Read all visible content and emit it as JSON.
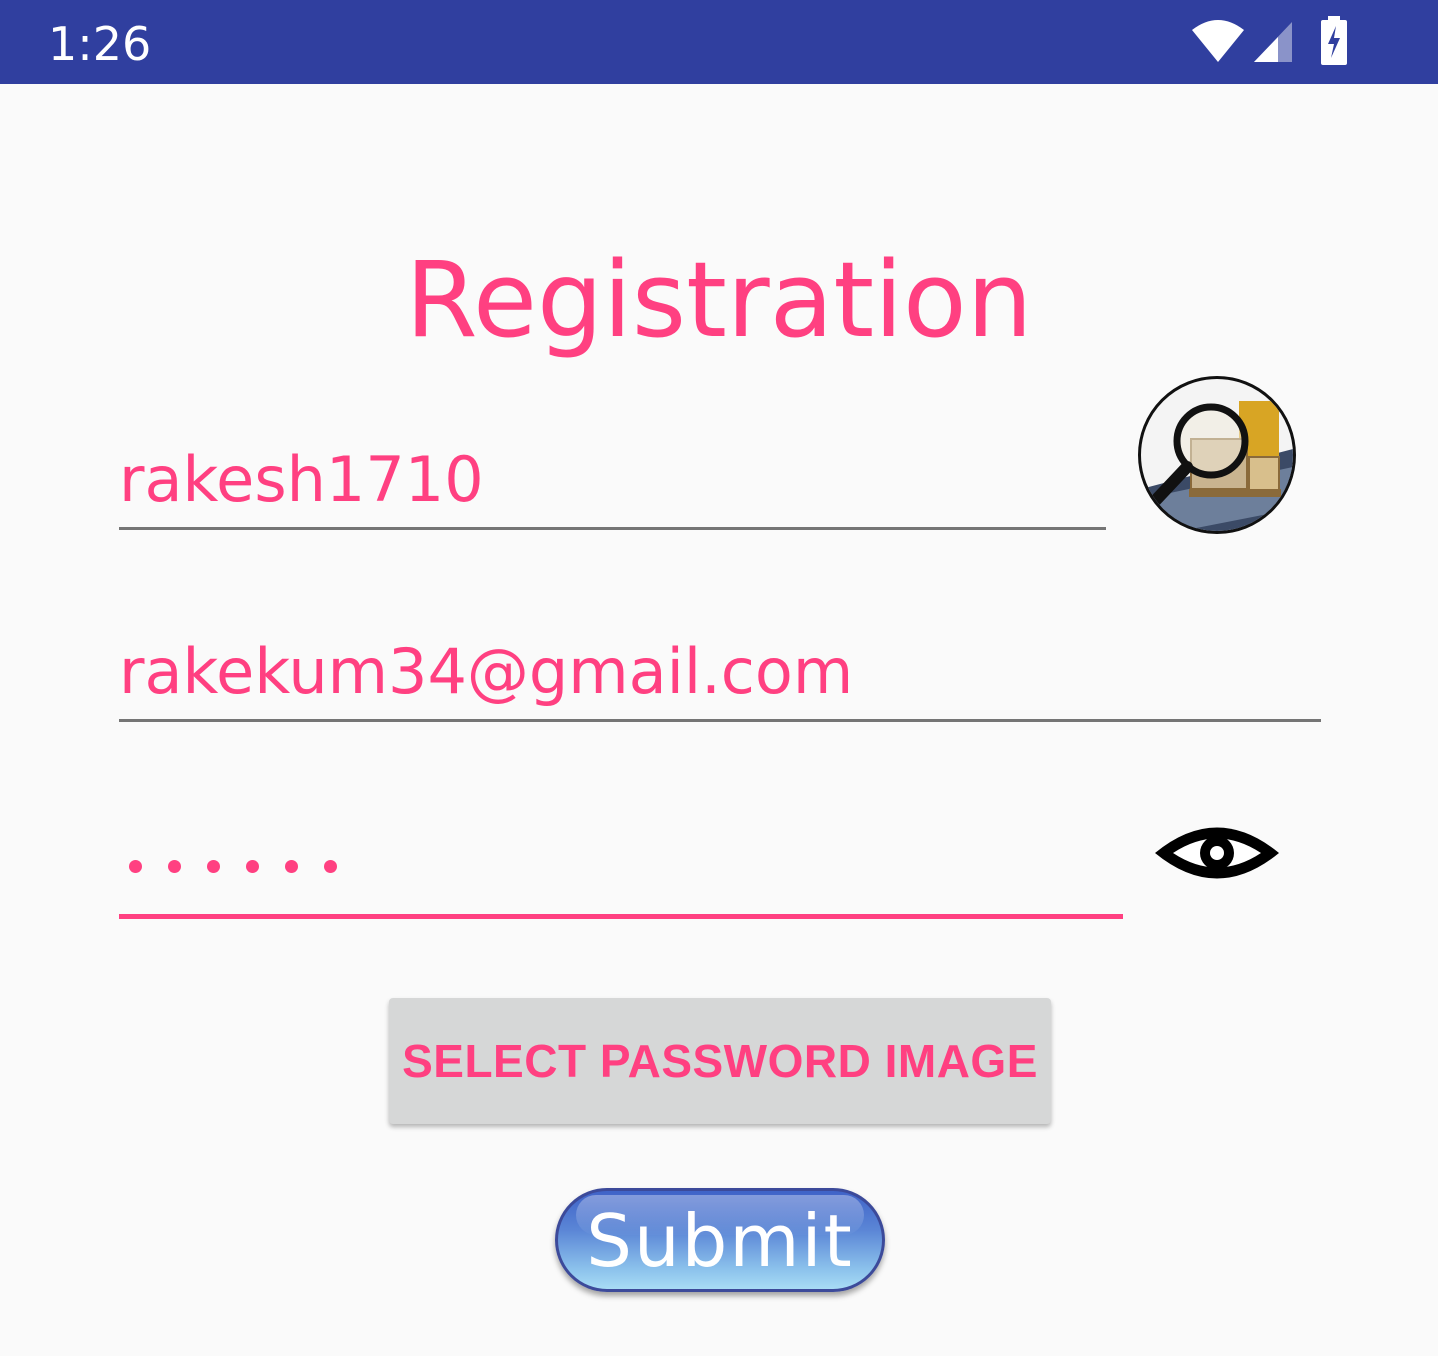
{
  "status_bar": {
    "time": "1:26",
    "icons": [
      "wifi-icon",
      "cell-signal-icon",
      "battery-charging-icon"
    ],
    "background": "#303f9f"
  },
  "form": {
    "title": "Registration",
    "username_value": "rakesh1710",
    "email_value": "rakekum34@gmail.com",
    "password_mask_length": 6,
    "select_image_label": "SELECT PASSWORD IMAGE",
    "submit_label": "Submit"
  },
  "colors": {
    "accent": "#ff4081",
    "primary_dark": "#303f9f",
    "button_gray": "#d6d7d7"
  }
}
